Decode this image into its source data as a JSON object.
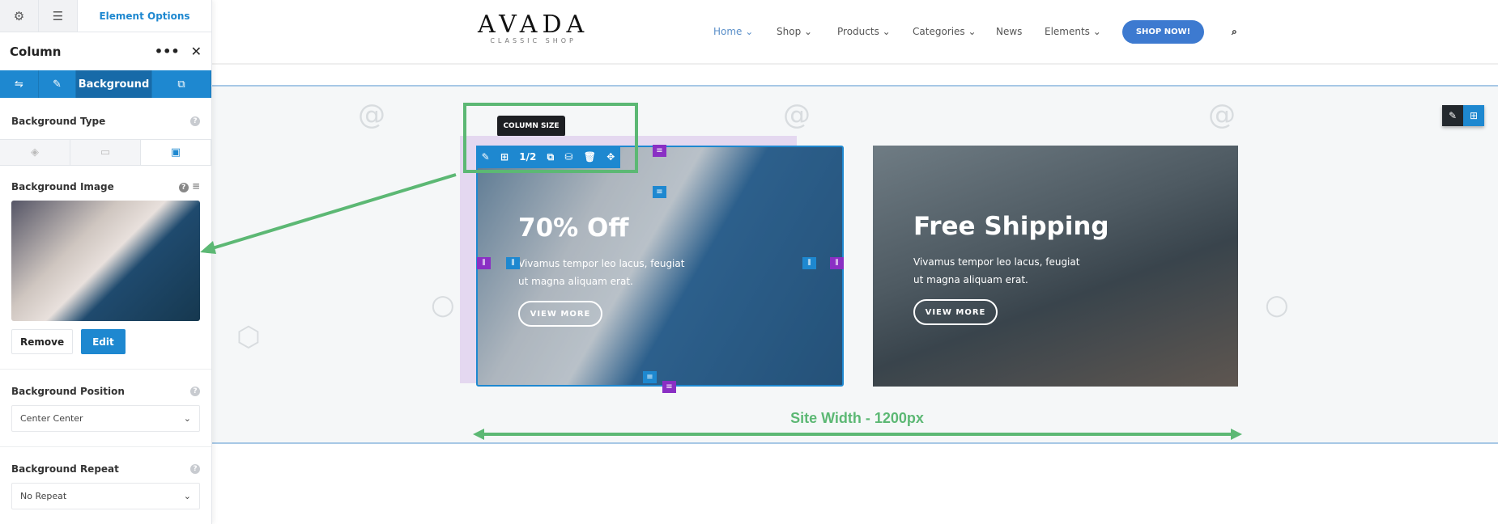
{
  "sidebar": {
    "top_tab_active": "Element Options",
    "top_tab_icons": [
      "gear-icon",
      "sliders-icon"
    ],
    "element_title": "Column",
    "more_label": "•••",
    "close_label": "✕",
    "tabs": [
      {
        "icon": "sliders-icon"
      },
      {
        "icon": "brush-icon"
      },
      {
        "label": "Background"
      },
      {
        "icon": "extras-icon"
      }
    ],
    "background_type_label": "Background Type",
    "background_type_options": [
      "color-icon",
      "gradient-icon",
      "image-icon"
    ],
    "background_image_label": "Background Image",
    "remove_label": "Remove",
    "edit_label": "Edit",
    "background_position_label": "Background Position",
    "background_position_value": "Center Center",
    "background_repeat_label": "Background Repeat",
    "background_repeat_value": "No Repeat"
  },
  "header": {
    "logo_main": "AVADA",
    "logo_sub": "CLASSIC SHOP",
    "nav": [
      {
        "label": "Home",
        "chevron": true,
        "active": true
      },
      {
        "label": "Shop",
        "chevron": true
      },
      {
        "label": "Products",
        "chevron": true
      },
      {
        "label": "Categories",
        "chevron": true
      },
      {
        "label": "News"
      },
      {
        "label": "Elements",
        "chevron": true
      }
    ],
    "cta": "SHOP NOW!"
  },
  "builder": {
    "tooltip": "COLUMN SIZE",
    "column_size": "1/2",
    "site_width_label": "Site Width - 1200px"
  },
  "columns": [
    {
      "title": "70% Off",
      "text": "Vivamus tempor leo lacus, feugiat ut magna aliquam erat.",
      "button": "VIEW MORE"
    },
    {
      "title": "Free Shipping",
      "text": "Vivamus tempor leo lacus, feugiat ut magna aliquam erat.",
      "button": "VIEW MORE"
    }
  ],
  "colors": {
    "accent": "#1e88d0",
    "annotation": "#5cb874",
    "column_handle": "#8a2fc4",
    "cta": "#3d7ad0"
  }
}
